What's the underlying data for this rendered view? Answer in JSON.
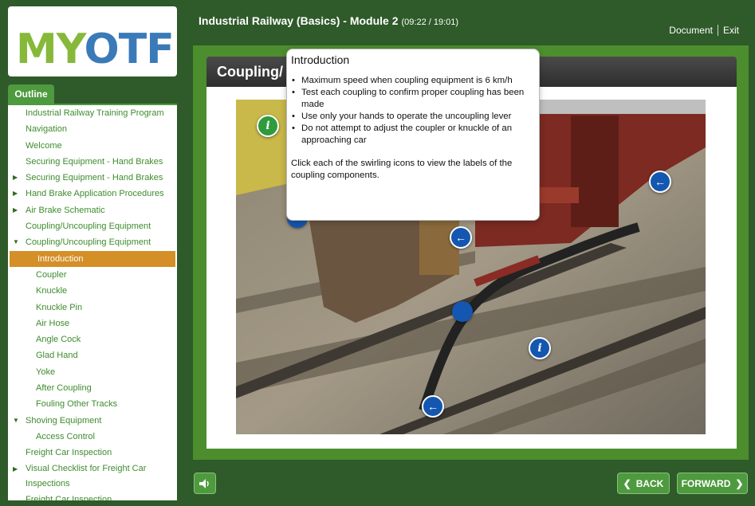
{
  "logo": {
    "text_part1": "MY",
    "text_part2": "OTF",
    "icon": "figure-logo"
  },
  "course": {
    "title": "Industrial Railway (Basics) - Module 2",
    "time": "(09:22 / 19:01)"
  },
  "topnav": {
    "document": "Document",
    "exit": "Exit"
  },
  "outline": {
    "tab_label": "Outline",
    "items": [
      {
        "label": "Industrial Railway Training Program",
        "level": 1,
        "arrow": ""
      },
      {
        "label": "Navigation",
        "level": 1,
        "arrow": ""
      },
      {
        "label": "Welcome",
        "level": 1,
        "arrow": ""
      },
      {
        "label": "Securing Equipment - Hand Brakes",
        "level": 1,
        "arrow": ""
      },
      {
        "label": "Securing Equipment - Hand Brakes",
        "level": 1,
        "arrow": "▶"
      },
      {
        "label": "Hand Brake Application Procedures",
        "level": 1,
        "arrow": "▶"
      },
      {
        "label": "Air Brake Schematic",
        "level": 1,
        "arrow": "▶"
      },
      {
        "label": "Coupling/Uncoupling Equipment",
        "level": 1,
        "arrow": ""
      },
      {
        "label": "Coupling/Uncoupling Equipment",
        "level": 1,
        "arrow": "▼"
      },
      {
        "label": "Introduction",
        "level": 2,
        "arrow": "",
        "active": true
      },
      {
        "label": "Coupler",
        "level": 2,
        "arrow": ""
      },
      {
        "label": "Knuckle",
        "level": 2,
        "arrow": ""
      },
      {
        "label": "Knuckle Pin",
        "level": 2,
        "arrow": ""
      },
      {
        "label": "Air Hose",
        "level": 2,
        "arrow": ""
      },
      {
        "label": "Angle Cock",
        "level": 2,
        "arrow": ""
      },
      {
        "label": "Glad Hand",
        "level": 2,
        "arrow": ""
      },
      {
        "label": "Yoke",
        "level": 2,
        "arrow": ""
      },
      {
        "label": "After Coupling",
        "level": 2,
        "arrow": ""
      },
      {
        "label": "Fouling Other Tracks",
        "level": 2,
        "arrow": ""
      },
      {
        "label": "Shoving Equipment",
        "level": 1,
        "arrow": "▼"
      },
      {
        "label": "Access Control",
        "level": 2,
        "arrow": ""
      },
      {
        "label": "Freight Car Inspection",
        "level": 1,
        "arrow": ""
      },
      {
        "label": "Visual Checklist for Freight Car Inspections",
        "level": 1,
        "arrow": "▶",
        "wrap": true
      },
      {
        "label": "Freight Car Inspection",
        "level": 1,
        "arrow": ""
      }
    ]
  },
  "slide": {
    "title": "Coupling/"
  },
  "popup": {
    "title": "Introduction",
    "bullets": [
      "Maximum  speed when coupling equipment is 6 km/h",
      "Test each coupling to confirm proper coupling has been made",
      "Use only your hands to operate the uncoupling lever",
      "Do not attempt to adjust the coupler or knuckle of an approaching car"
    ],
    "note": "Click each of the swirling icons to view the labels of the coupling components."
  },
  "controls": {
    "back": "BACK",
    "forward": "FORWARD"
  },
  "colors": {
    "accent_green": "#4e9a3f",
    "active_orange": "#d48f27",
    "hotspot_blue": "#1457b0"
  }
}
